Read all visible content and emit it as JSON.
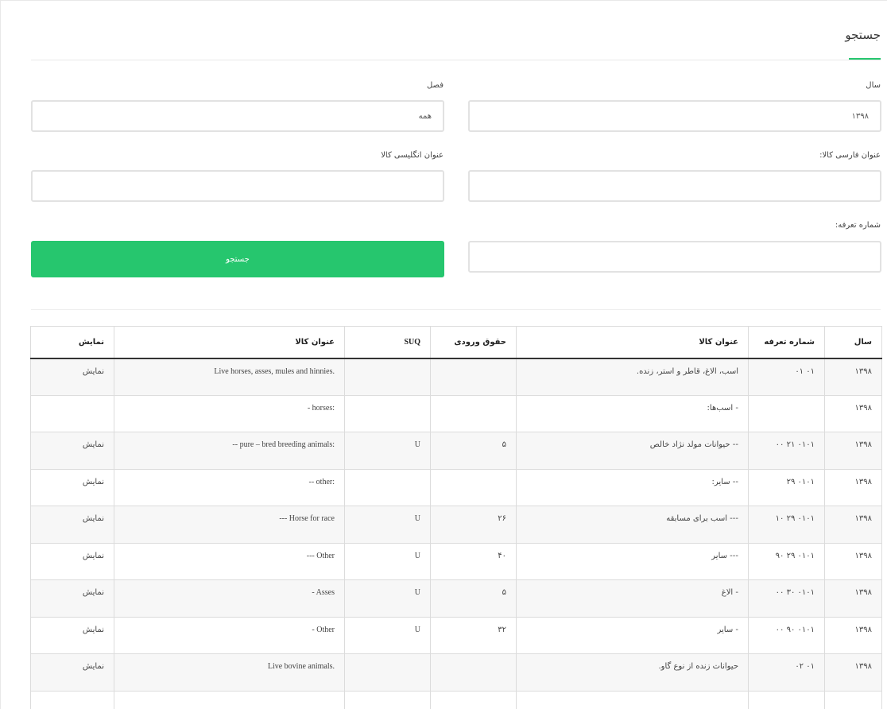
{
  "header": {
    "title": "جستجو"
  },
  "form": {
    "year_label": "سال",
    "year_value": "۱۳۹۸",
    "season_label": "فصل",
    "season_value": "همه",
    "fa_title_label": "عنوان فارسی کالا:",
    "fa_title_value": "",
    "en_title_label": "عنوان انگلیسی کالا",
    "en_title_value": "",
    "tariff_label": "شماره تعرفه:",
    "tariff_value": "",
    "search_button": "جستجو"
  },
  "table": {
    "headers": {
      "year": "سال",
      "tariff": "شماره تعرفه",
      "fa_title": "عنوان کالا",
      "duty": "حقوق ورودی",
      "suq": "SUQ",
      "en_title": "عنوان کالا",
      "show": "نمایش"
    },
    "rows": [
      {
        "year": "۱۳۹۸",
        "tariff": "۰۱ ۰۱",
        "fa_title": "اسب، الاغ، قاطر و استر، زنده.",
        "duty": "",
        "suq": "",
        "en_title": "Live horses, asses, mules and hinnies.",
        "show": "نمایش"
      },
      {
        "year": "۱۳۹۸",
        "tariff": "",
        "fa_title": "- اسب‌ها:",
        "duty": "",
        "suq": "",
        "en_title": "- horses:",
        "show": ""
      },
      {
        "year": "۱۳۹۸",
        "tariff": "۰۱۰۱ ۲۱ ۰۰",
        "fa_title": "-- حیوانات مولد نژاد خالص",
        "duty": "۵",
        "suq": "U",
        "en_title": "-- pure – bred breeding animals:",
        "show": "نمایش"
      },
      {
        "year": "۱۳۹۸",
        "tariff": "۰۱۰۱ ۲۹",
        "fa_title": "-- سایر:",
        "duty": "",
        "suq": "",
        "en_title": "-- other:",
        "show": "نمایش"
      },
      {
        "year": "۱۳۹۸",
        "tariff": "۰۱۰۱ ۲۹ ۱۰",
        "fa_title": "--- اسب برای مسابقه",
        "duty": "۲۶",
        "suq": "U",
        "en_title": "--- Horse for race",
        "show": "نمایش"
      },
      {
        "year": "۱۳۹۸",
        "tariff": "۰۱۰۱ ۲۹ ۹۰",
        "fa_title": "--- سایر",
        "duty": "۴۰",
        "suq": "U",
        "en_title": "--- Other",
        "show": "نمایش"
      },
      {
        "year": "۱۳۹۸",
        "tariff": "۰۱۰۱ ۳۰ ۰۰",
        "fa_title": "- الاغ",
        "duty": "۵",
        "suq": "U",
        "en_title": "- Asses",
        "show": "نمایش"
      },
      {
        "year": "۱۳۹۸",
        "tariff": "۰۱۰۱ ۹۰ ۰۰",
        "fa_title": "- سایر",
        "duty": "۳۲",
        "suq": "U",
        "en_title": "- Other",
        "show": "نمایش"
      },
      {
        "year": "۱۳۹۸",
        "tariff": "۰۱ ۰۲",
        "fa_title": "حیوانات زنده از نوع گاو.",
        "duty": "",
        "suq": "",
        "en_title": "Live bovine animals.",
        "show": "نمایش"
      },
      {
        "year": "",
        "tariff": "",
        "fa_title": "",
        "duty": "",
        "suq": "",
        "en_title": "",
        "show": ""
      }
    ]
  }
}
